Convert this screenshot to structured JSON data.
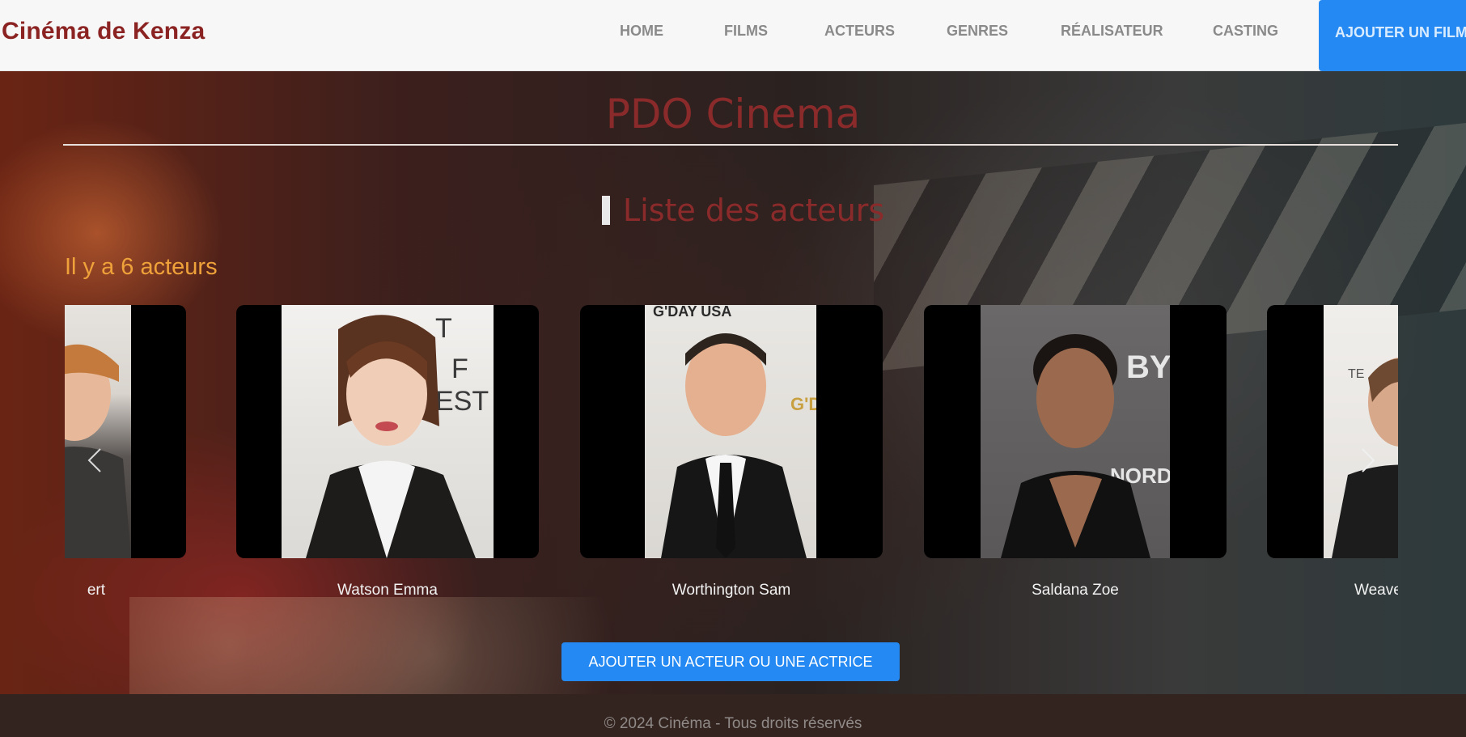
{
  "navbar": {
    "brand": "Cinéma de Kenza",
    "links": [
      "HOME",
      "FILMS",
      "ACTEURS",
      "GENRES",
      "RÉALISATEUR",
      "CASTING"
    ],
    "cta": "AJOUTER UN FILM"
  },
  "hero": {
    "title": "PDO Cinema",
    "section_heading": "Liste des acteurs",
    "count_text": "Il y a 6 acteurs"
  },
  "carousel": {
    "prev_icon": "chevron-left-icon",
    "next_icon": "chevron-right-icon",
    "actors": [
      {
        "name": "Grint Rupert",
        "visible_name": "ert"
      },
      {
        "name": "Watson Emma",
        "visible_name": "Watson Emma"
      },
      {
        "name": "Worthington Sam",
        "visible_name": "Worthington Sam"
      },
      {
        "name": "Saldana Zoe",
        "visible_name": "Saldana Zoe"
      },
      {
        "name": "Weaver Sigourney",
        "visible_name": "Weave"
      }
    ]
  },
  "add_actor_button": "AJOUTER UN ACTEUR OU UNE ACTRICE",
  "footer": {
    "text": "© 2024 Cinéma - Tous droits réservés"
  },
  "colors": {
    "brand": "#8b2323",
    "accent": "#2489f2",
    "count": "#f0a23a",
    "footer_bg": "#34241f"
  }
}
